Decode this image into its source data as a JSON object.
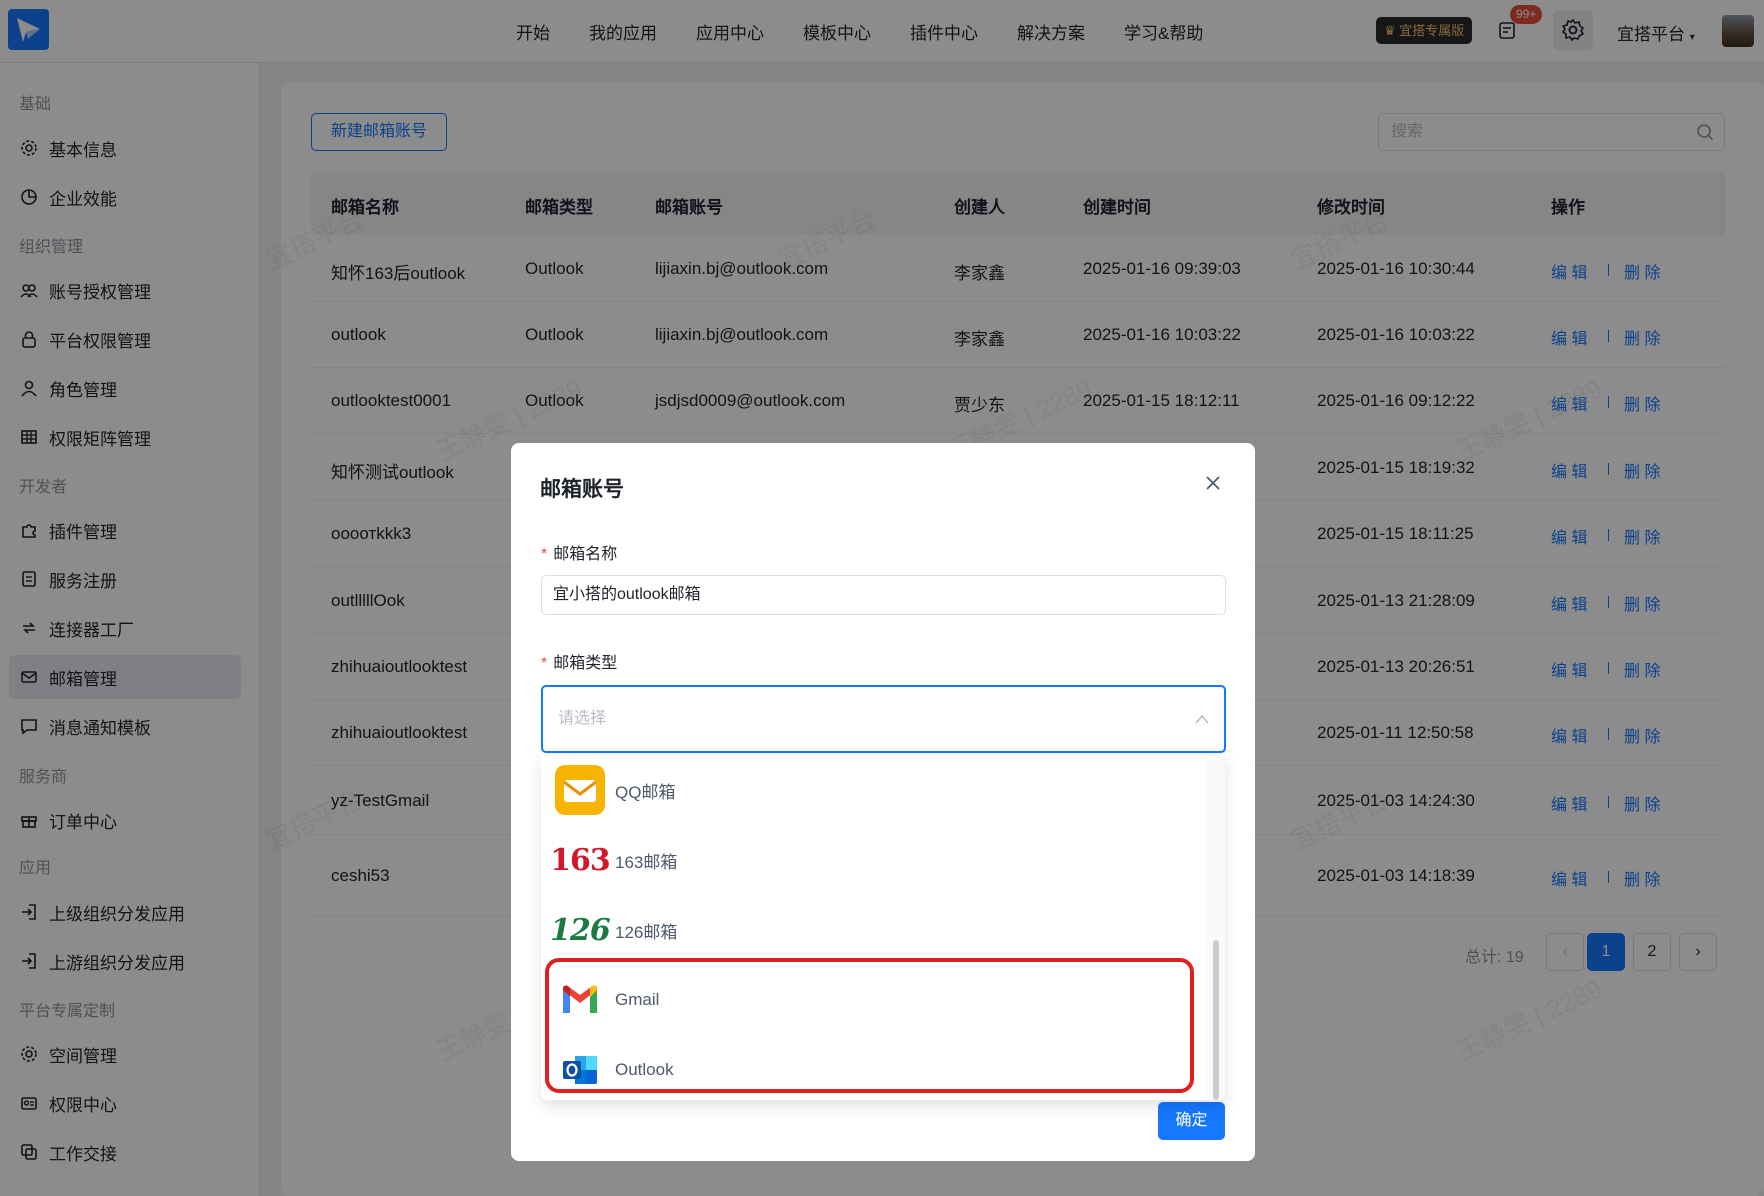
{
  "topbar": {
    "nav": [
      "开始",
      "我的应用",
      "应用中心",
      "模板中心",
      "插件中心",
      "解决方案",
      "学习&帮助"
    ],
    "edition_badge": "宜搭专属版",
    "notif_count": "99+",
    "org_name": "宜搭平台"
  },
  "sidebar": {
    "groups": {
      "basic": "基础",
      "org": "组织管理",
      "dev": "开发者",
      "vendor": "服务商",
      "app": "应用",
      "custom": "平台专属定制"
    },
    "items": [
      "基本信息",
      "企业效能",
      "账号授权管理",
      "平台权限管理",
      "角色管理",
      "权限矩阵管理",
      "插件管理",
      "服务注册",
      "连接器工厂",
      "邮箱管理",
      "消息通知模板",
      "订单中心",
      "上级组织分发应用",
      "上游组织分发应用",
      "空间管理",
      "权限中心",
      "工作交接"
    ]
  },
  "toolbar": {
    "new_label": "新建邮箱账号",
    "search_placeholder": "搜索"
  },
  "table": {
    "headers": [
      "邮箱名称",
      "邮箱类型",
      "邮箱账号",
      "创建人",
      "创建时间",
      "修改时间",
      "操作"
    ],
    "rows": [
      {
        "name": "知怀163后outlook",
        "type": "Outlook",
        "account": "lijiaxin.bj@outlook.com",
        "creator": "李家鑫",
        "created": "2025-01-16 09:39:03",
        "modified": "2025-01-16 10:30:44"
      },
      {
        "name": "outlook",
        "type": "Outlook",
        "account": "lijiaxin.bj@outlook.com",
        "creator": "李家鑫",
        "created": "2025-01-16 10:03:22",
        "modified": "2025-01-16 10:03:22"
      },
      {
        "name": "outlooktest0001",
        "type": "Outlook",
        "account": "jsdjsd0009@outlook.com",
        "creator": "贾少东",
        "created": "2025-01-15 18:12:11",
        "modified": "2025-01-16 09:12:22"
      },
      {
        "name": "知怀测试outlook",
        "modified": "2025-01-15 18:19:32"
      },
      {
        "name": "oooотkkk3",
        "modified": "2025-01-15 18:11:25"
      },
      {
        "name": "outlllllOok",
        "modified": "2025-01-13 21:28:09"
      },
      {
        "name": "zhihuaioutlooktest",
        "modified": "2025-01-13 20:26:51"
      },
      {
        "name": "zhihuaioutlooktest",
        "modified": "2025-01-11 12:50:58"
      },
      {
        "name": "yz-TestGmail",
        "modified": "2025-01-03 14:24:30"
      },
      {
        "name": "ceshi53",
        "modified": "2025-01-03 14:18:39"
      }
    ],
    "edit_label": "编 辑",
    "delete_label": "删 除"
  },
  "pagination": {
    "total": "总计: 19",
    "pages": [
      "1",
      "2"
    ],
    "current": "1"
  },
  "watermark": {
    "text1": "宜搭平台",
    "text2": "王静雯 | 2289"
  },
  "modal": {
    "title": "邮箱账号",
    "name_label": "邮箱名称",
    "name_value": "宜小搭的outlook邮箱",
    "type_label": "邮箱类型",
    "type_placeholder": "请选择",
    "confirm_label": "确定",
    "options": [
      {
        "label": "QQ邮箱",
        "logo_text": ""
      },
      {
        "label": "163邮箱",
        "logo_text": "163"
      },
      {
        "label": "126邮箱",
        "logo_text": "126"
      },
      {
        "label": "Gmail",
        "logo_text": ""
      },
      {
        "label": "Outlook",
        "logo_text": ""
      }
    ]
  },
  "colors": {
    "primary": "#1677ff",
    "highlight": "#e02020"
  }
}
